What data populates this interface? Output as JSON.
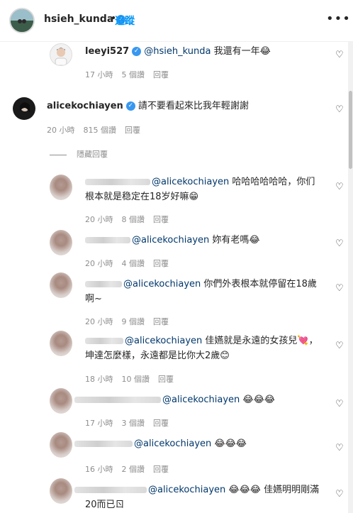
{
  "header": {
    "username": "hsieh_kunda",
    "follow": "追蹤",
    "more": "•••"
  },
  "comments": [
    {
      "username": "leeyi527",
      "mention": "@hsieh_kunda",
      "text": " 我還有一年😂",
      "time": "17 小時",
      "likes": "5 個讚",
      "reply": "回覆"
    },
    {
      "username": "alicekochiayen",
      "text": "請不要看起來比我年輕謝謝",
      "time": "20 小時",
      "likes": "815 個讚",
      "reply": "回覆"
    }
  ],
  "hide_replies": "隱藏回覆",
  "replies": [
    {
      "mention": "@alicekochiayen",
      "line1": " 哈哈哈哈哈哈，你们",
      "line2": "根本就是稳定在18岁好嘛😁",
      "time": "20 小時",
      "likes": "8 個讚",
      "reply": "回覆"
    },
    {
      "mention": "@alicekochiayen",
      "line1": " 妳有老嗎😂",
      "time": "20 小時",
      "likes": "4 個讚",
      "reply": "回覆"
    },
    {
      "mention": "@alicekochiayen",
      "line1": " 你們外表根本就停留在18歲",
      "line2": "啊~",
      "time": "20 小時",
      "likes": "9 個讚",
      "reply": "回覆"
    },
    {
      "mention": "@alicekochiayen",
      "line1": " 佳嬿就是永遠的女孩兒💘，",
      "line2": "坤達怎麼樣，永遠都是比你大2歲😊",
      "time": "18 小時",
      "likes": "10 個讚",
      "reply": "回覆"
    },
    {
      "mention": "@alicekochiayen",
      "line1": " 😂😂😂",
      "time": "17 小時",
      "likes": "3 個讚",
      "reply": "回覆"
    },
    {
      "mention": "@alicekochiayen",
      "line1": " 😂😂😂",
      "time": "16 小時",
      "likes": "2 個讚",
      "reply": "回覆"
    },
    {
      "mention": "@alicekochiayen",
      "line1": " 😂😂😂 佳嬿明明剛滿",
      "line2": "20而已ㄖ"
    }
  ],
  "icons": {
    "heart": "heart-icon",
    "verified": "verified-badge-icon"
  }
}
